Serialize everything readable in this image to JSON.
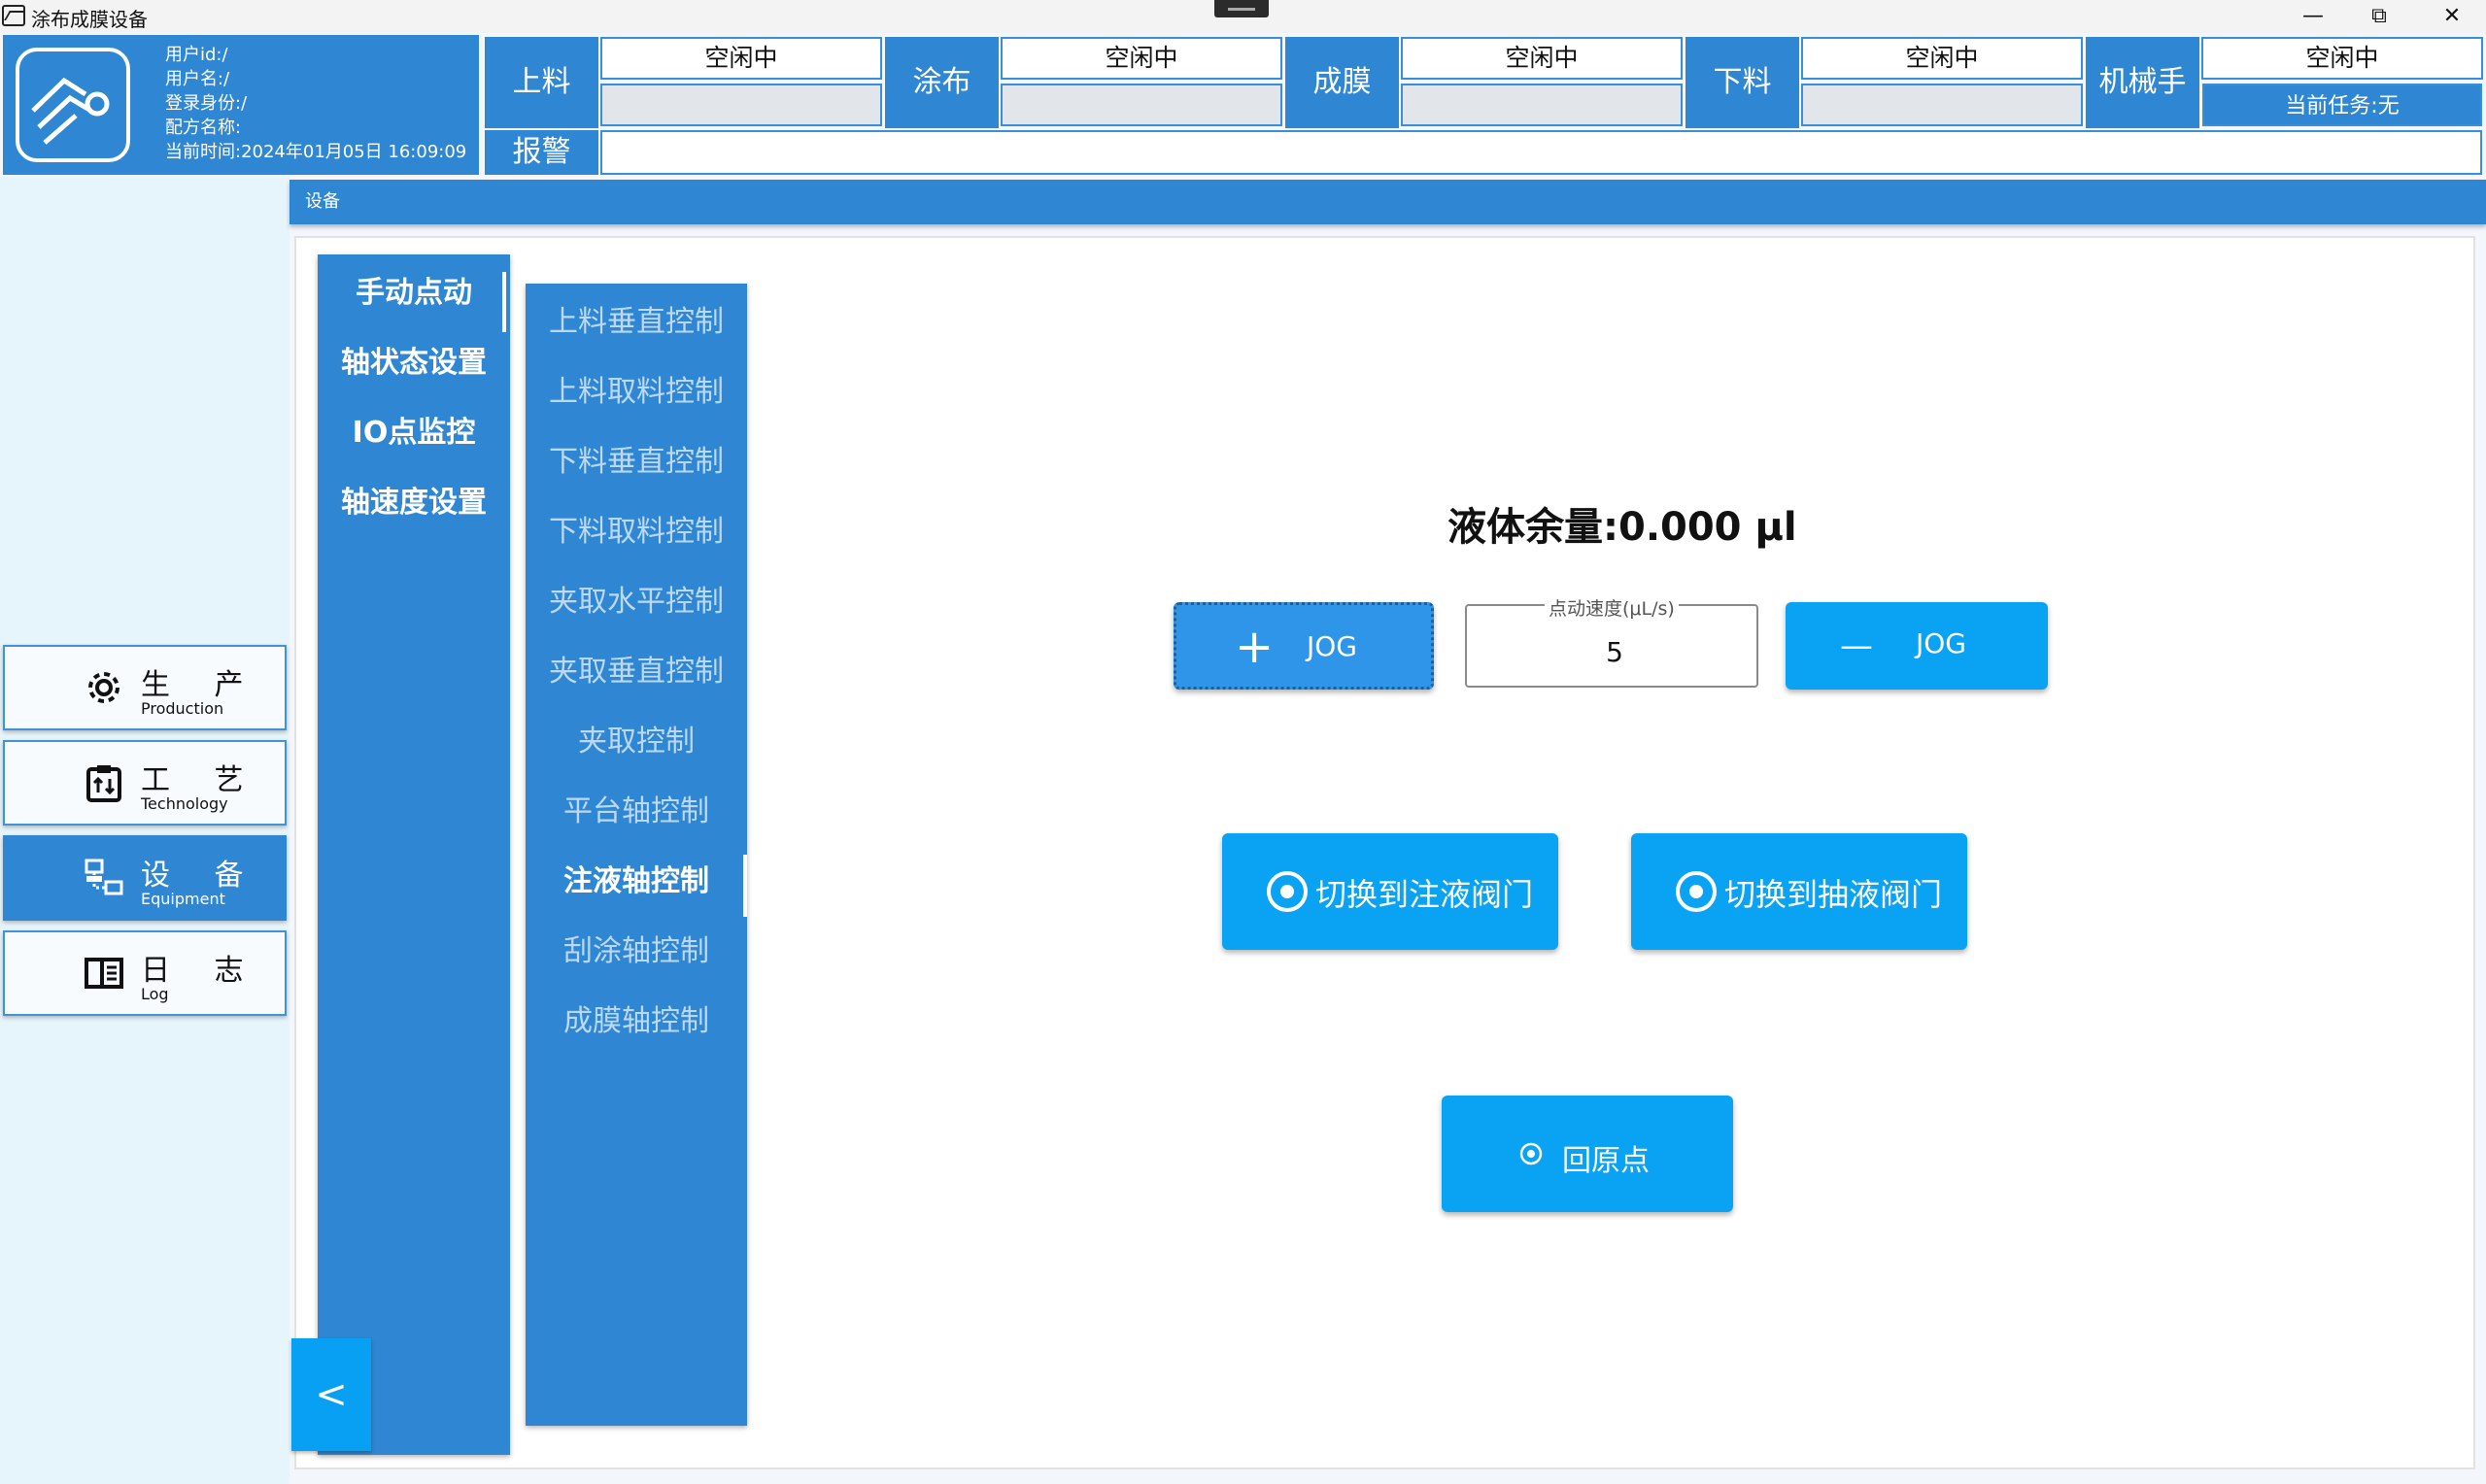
{
  "window": {
    "title": "涂布成膜设备"
  },
  "user": {
    "id": "用户id:/",
    "name": "用户名:/",
    "role": "登录身份:/",
    "recipe": "配方名称:",
    "time": "当前时间:2024年01月05日 16:09:09"
  },
  "stages": [
    {
      "label": "上料",
      "status": "空闲中"
    },
    {
      "label": "涂布",
      "status": "空闲中"
    },
    {
      "label": "成膜",
      "status": "空闲中"
    },
    {
      "label": "下料",
      "status": "空闲中"
    },
    {
      "label": "机械手",
      "status": "空闲中"
    }
  ],
  "current_task": "当前任务:无",
  "alarm_label": "报警",
  "side_nav": [
    {
      "cn": "生 产",
      "en": "Production",
      "icon": "gear-icon"
    },
    {
      "cn": "工 艺",
      "en": "Technology",
      "icon": "clipboard-icon"
    },
    {
      "cn": "设 备",
      "en": "Equipment",
      "icon": "network-icon",
      "active": true
    },
    {
      "cn": "日 志",
      "en": "Log",
      "icon": "book-icon"
    }
  ],
  "main_title": "设备",
  "menu_l1": [
    "手动点动",
    "轴状态设置",
    "IO点监控",
    "轴速度设置"
  ],
  "menu_l2": [
    "上料垂直控制",
    "上料取料控制",
    "下料垂直控制",
    "下料取料控制",
    "夹取水平控制",
    "夹取垂直控制",
    "夹取控制",
    "平台轴控制",
    "注液轴控制",
    "刮涂轴控制",
    "成膜轴控制"
  ],
  "collapse_label": "<",
  "panel": {
    "liquid": "液体余量:0.000 μl",
    "jog_plus_symbol": "+",
    "jog_minus_symbol": "—",
    "jog_label": "JOG",
    "speed_label": "点动速度(μL/s)",
    "speed_value": "5",
    "to_inject_valve": "切换到注液阀门",
    "to_draw_valve": "切换到抽液阀门",
    "home": "回原点"
  },
  "colors": {
    "primary": "#2f87d3",
    "accent": "#0aa3f3"
  }
}
